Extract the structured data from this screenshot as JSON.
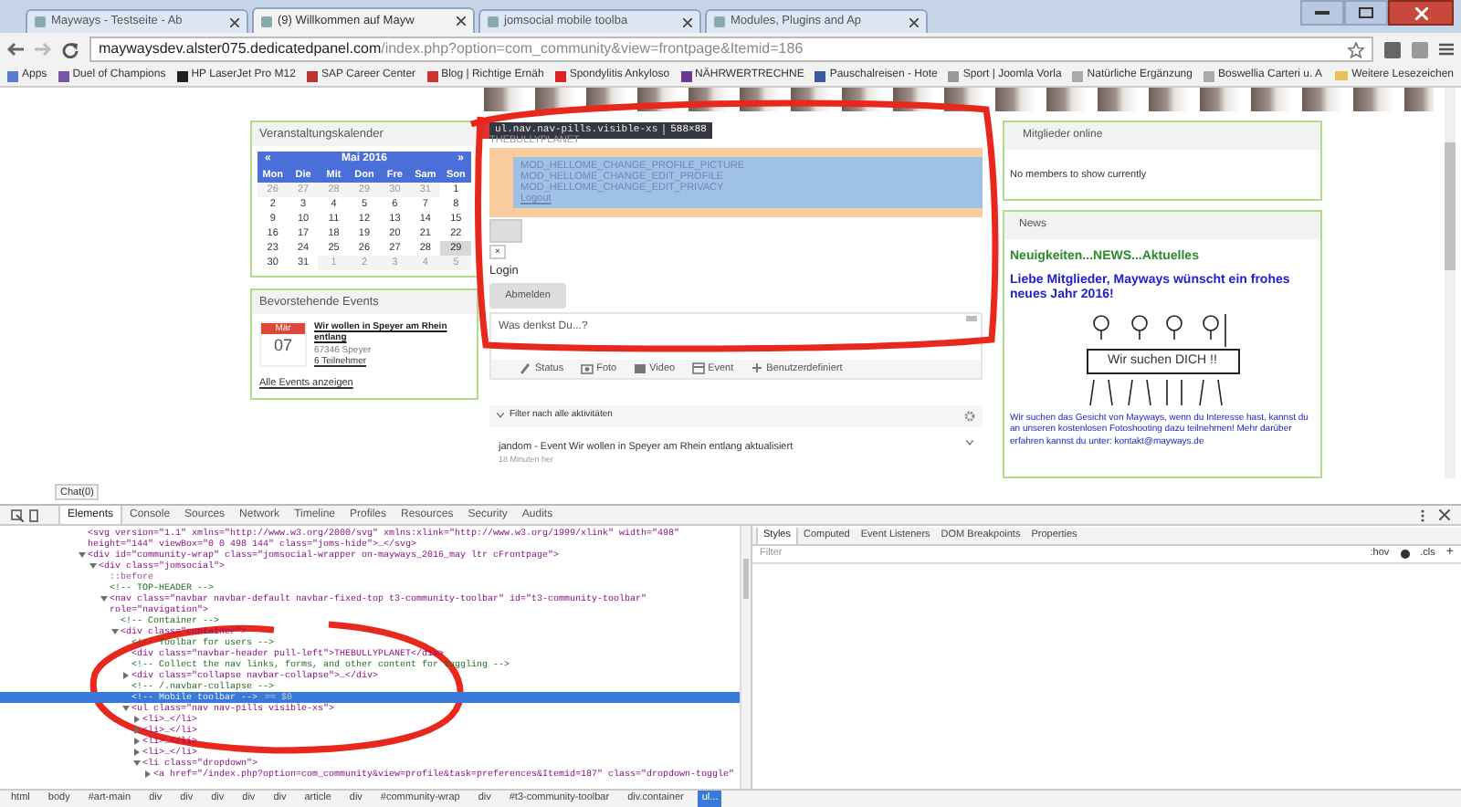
{
  "browser": {
    "tabs": [
      {
        "title": "Mayways - Testseite - Ab",
        "selected": false
      },
      {
        "title": "(9) Willkommen auf Mayw",
        "selected": true
      },
      {
        "title": "jomsocial mobile toolba",
        "selected": false
      },
      {
        "title": "Modules, Plugins and Ap",
        "selected": false
      }
    ],
    "url": {
      "host": "maywaysdev.alster075.dedicatedpanel.com",
      "path": "/index.php?option=com_community&view=frontpage&Itemid=186"
    },
    "bookmarks": [
      "Apps",
      "Duel of Champions",
      "HP LaserJet Pro M12",
      "SAP Career Center",
      "Blog | Richtige Ernäh",
      "Spondylitis Ankyloso",
      "NÄHRWERTRECHNE",
      "Pauschalreisen - Hote",
      "Sport | Joomla Vorla",
      "Natürliche Ergänzung",
      "Boswellia Carteri u. A"
    ],
    "other_bookmarks": "Weitere Lesezeichen"
  },
  "calendar": {
    "title": "Veranstaltungskalender",
    "prev": "«",
    "month": "Mai 2016",
    "next": "»",
    "weekdays": [
      "Mon",
      "Die",
      "Mit",
      "Don",
      "Fre",
      "Sam",
      "Son"
    ],
    "weeks": [
      [
        {
          "d": "26",
          "muted": true,
          "selected": false
        },
        {
          "d": "27",
          "muted": true,
          "selected": false
        },
        {
          "d": "28",
          "muted": true,
          "selected": false
        },
        {
          "d": "29",
          "muted": true,
          "selected": false
        },
        {
          "d": "30",
          "muted": true,
          "selected": false
        },
        {
          "d": "31",
          "muted": true,
          "selected": false
        },
        {
          "d": "1",
          "muted": false,
          "selected": false
        }
      ],
      [
        {
          "d": "2",
          "muted": false,
          "selected": false
        },
        {
          "d": "3",
          "muted": false,
          "selected": false
        },
        {
          "d": "4",
          "muted": false,
          "selected": false
        },
        {
          "d": "5",
          "muted": false,
          "selected": false
        },
        {
          "d": "6",
          "muted": false,
          "selected": false
        },
        {
          "d": "7",
          "muted": false,
          "selected": false
        },
        {
          "d": "8",
          "muted": false,
          "selected": false
        }
      ],
      [
        {
          "d": "9",
          "muted": false,
          "selected": false
        },
        {
          "d": "10",
          "muted": false,
          "selected": false
        },
        {
          "d": "11",
          "muted": false,
          "selected": false
        },
        {
          "d": "12",
          "muted": false,
          "selected": false
        },
        {
          "d": "13",
          "muted": false,
          "selected": false
        },
        {
          "d": "14",
          "muted": false,
          "selected": false
        },
        {
          "d": "15",
          "muted": false,
          "selected": false
        }
      ],
      [
        {
          "d": "16",
          "muted": false,
          "selected": false
        },
        {
          "d": "17",
          "muted": false,
          "selected": false
        },
        {
          "d": "18",
          "muted": false,
          "selected": false
        },
        {
          "d": "19",
          "muted": false,
          "selected": false
        },
        {
          "d": "20",
          "muted": false,
          "selected": false
        },
        {
          "d": "21",
          "muted": false,
          "selected": false
        },
        {
          "d": "22",
          "muted": false,
          "selected": false
        }
      ],
      [
        {
          "d": "23",
          "muted": false,
          "selected": false
        },
        {
          "d": "24",
          "muted": false,
          "selected": false
        },
        {
          "d": "25",
          "muted": false,
          "selected": false
        },
        {
          "d": "26",
          "muted": false,
          "selected": false
        },
        {
          "d": "27",
          "muted": false,
          "selected": false
        },
        {
          "d": "28",
          "muted": false,
          "selected": false
        },
        {
          "d": "29",
          "muted": false,
          "selected": true
        }
      ],
      [
        {
          "d": "30",
          "muted": false,
          "selected": false
        },
        {
          "d": "31",
          "muted": false,
          "selected": false
        },
        {
          "d": "1",
          "muted": true,
          "selected": false
        },
        {
          "d": "2",
          "muted": true,
          "selected": false
        },
        {
          "d": "3",
          "muted": true,
          "selected": false
        },
        {
          "d": "4",
          "muted": true,
          "selected": false
        },
        {
          "d": "5",
          "muted": true,
          "selected": false
        }
      ]
    ]
  },
  "events": {
    "title": "Bevorstehende Events",
    "items": [
      {
        "month": "Mär",
        "day": "07",
        "title": "Wir wollen in Speyer am Rhein entlang",
        "place": "67346 Speyer",
        "attendees": "6 Teilnehmer"
      }
    ],
    "all_link": "Alle Events anzeigen"
  },
  "inspector_tooltip": {
    "selector": "ul.nav.nav-pills.visible-xs",
    "size": "588×88"
  },
  "toolbar_preview": {
    "brand": "THEBULLYPLANET",
    "menu_items": [
      "MOD_HELLOME_CHANGE_PROFILE_PICTURE",
      "MOD_HELLOME_CHANGE_EDIT_PROFILE",
      "MOD_HELLOME_CHANGE_EDIT_PRIVACY",
      "Logout"
    ],
    "close": "×",
    "login": "Login",
    "logout_button": "Abmelden"
  },
  "composer": {
    "placeholder": "Was denkst Du...?",
    "actions": [
      {
        "kind": "status",
        "label": "Status"
      },
      {
        "kind": "photo",
        "label": "Foto"
      },
      {
        "kind": "video",
        "label": "Video"
      },
      {
        "kind": "event",
        "label": "Event"
      },
      {
        "kind": "custom",
        "label": "Benutzerdefiniert"
      }
    ]
  },
  "filter": "Filter nach alle aktivitäten",
  "activity": [
    {
      "text": "jandom - Event Wir wollen in Speyer am Rhein entlang aktualisiert",
      "time": "18 Minuten her"
    }
  ],
  "members_online": {
    "title": "Mitglieder online",
    "text": "No members to show currently"
  },
  "news": {
    "title": "News",
    "heading": "Neuigkeiten...NEWS...Aktuelles",
    "greeting": "Liebe Mitglieder, Mayways wünscht ein frohes neues Jahr 2016!",
    "banner": "Wir suchen DICH !!",
    "body": "Wir suchen das Gesicht von Mayways, wenn du Interesse hast, kannst du an unseren kostenlosen Fotoshooting dazu teilnehmen! Mehr darüber erfahren kannst du unter: kontakt@mayways.de"
  },
  "chat": "Chat(0)",
  "devtools": {
    "tabs": [
      {
        "label": "Elements",
        "selected": true
      },
      {
        "label": "Console",
        "selected": false
      },
      {
        "label": "Sources",
        "selected": false
      },
      {
        "label": "Network",
        "selected": false
      },
      {
        "label": "Timeline",
        "selected": false
      },
      {
        "label": "Profiles",
        "selected": false
      },
      {
        "label": "Resources",
        "selected": false
      },
      {
        "label": "Security",
        "selected": false
      },
      {
        "label": "Audits",
        "selected": false
      }
    ],
    "dom": [
      {
        "kind": "element",
        "text": "<svg version=\"1.1\" xmlns=\"http://www.w3.org/2000/svg\" xmlns:xlink=\"http://www.w3.org/1999/xlink\" width=\"498\" height=\"144\" viewBox=\"0 0 498 144\" class=\"joms-hide\">…</svg>",
        "selected": false
      },
      {
        "kind": "element",
        "text": "<div id=\"community-wrap\" class=\"jomsocial-wrapper on-mayways_2016_may ltr cFrontpage\">",
        "expanded": true,
        "selected": false,
        "children": [
          {
            "kind": "element",
            "text": "<div class=\"jomsocial\">",
            "expanded": true,
            "selected": false,
            "children": [
              {
                "kind": "pseudo",
                "text": "::before",
                "selected": false
              },
              {
                "kind": "comment",
                "text": "<!-- TOP-HEADER -->",
                "selected": false
              },
              {
                "kind": "element",
                "text": "<nav class=\"navbar navbar-default navbar-fixed-top t3-community-toolbar\" id=\"t3-community-toolbar\" role=\"navigation\">",
                "expanded": true,
                "selected": false,
                "children": [
                  {
                    "kind": "comment",
                    "text": "<!-- Container -->",
                    "selected": false
                  },
                  {
                    "kind": "element",
                    "text": "<div class=\"container\">",
                    "expanded": true,
                    "selected": false,
                    "children": [
                      {
                        "kind": "comment",
                        "text": "<!-- Toolbar for users -->",
                        "selected": false
                      },
                      {
                        "kind": "element",
                        "text": "<div class=\"navbar-header pull-left\">THEBULLYPLANET</div>",
                        "selected": false
                      },
                      {
                        "kind": "comment",
                        "text": "<!-- Collect the nav links, forms, and other content for toggling -->",
                        "selected": false
                      },
                      {
                        "kind": "element",
                        "text": "<div class=\"collapse navbar-collapse\">…</div>",
                        "expanded": false,
                        "selected": false
                      },
                      {
                        "kind": "comment",
                        "text": "<!-- /.navbar-collapse -->",
                        "selected": false
                      },
                      {
                        "kind": "comment",
                        "text": "<!-- Mobile toolbar -->",
                        "suffix": "== $0",
                        "selected": true
                      },
                      {
                        "kind": "element",
                        "text": "<ul class=\"nav nav-pills visible-xs\">",
                        "expanded": true,
                        "selected": false,
                        "children": [
                          {
                            "kind": "element",
                            "text": "<li>…</li>",
                            "expanded": false,
                            "selected": false
                          },
                          {
                            "kind": "element",
                            "text": "<li>…</li>",
                            "expanded": false,
                            "selected": false
                          },
                          {
                            "kind": "element",
                            "text": "<li>…</li>",
                            "expanded": false,
                            "selected": false
                          },
                          {
                            "kind": "element",
                            "text": "<li>…</li>",
                            "expanded": false,
                            "selected": false
                          },
                          {
                            "kind": "element",
                            "text": "<li class=\"dropdown\">",
                            "expanded": true,
                            "selected": false,
                            "children": [
                              {
                                "kind": "element",
                                "text": "<a href=\"/index.php?option=com_community&view=profile&task=preferences&Itemid=187\" class=\"dropdown-toggle\"",
                                "expanded": false,
                                "selected": false
                              }
                            ]
                          }
                        ]
                      }
                    ]
                  }
                ]
              }
            ]
          }
        ]
      }
    ],
    "breadcrumbs": [
      {
        "label": "html",
        "selected": false
      },
      {
        "label": "body",
        "selected": false
      },
      {
        "label": "#art-main",
        "selected": false
      },
      {
        "label": "div",
        "selected": false
      },
      {
        "label": "div",
        "selected": false
      },
      {
        "label": "div",
        "selected": false
      },
      {
        "label": "div",
        "selected": false
      },
      {
        "label": "div",
        "selected": false
      },
      {
        "label": "article",
        "selected": false
      },
      {
        "label": "div",
        "selected": false
      },
      {
        "label": "#community-wrap",
        "selected": false
      },
      {
        "label": "div",
        "selected": false
      },
      {
        "label": "#t3-community-toolbar",
        "selected": false
      },
      {
        "label": "div.container",
        "selected": false
      },
      {
        "label": "ul...",
        "selected": true
      }
    ],
    "side_tabs": [
      {
        "label": "Styles",
        "selected": true
      },
      {
        "label": "Computed",
        "selected": false
      },
      {
        "label": "Event Listeners",
        "selected": false
      },
      {
        "label": "DOM Breakpoints",
        "selected": false
      },
      {
        "label": "Properties",
        "selected": false
      }
    ],
    "filter_placeholder": "Filter",
    "hov": ":hov",
    "cls": ".cls",
    "add": "+"
  }
}
